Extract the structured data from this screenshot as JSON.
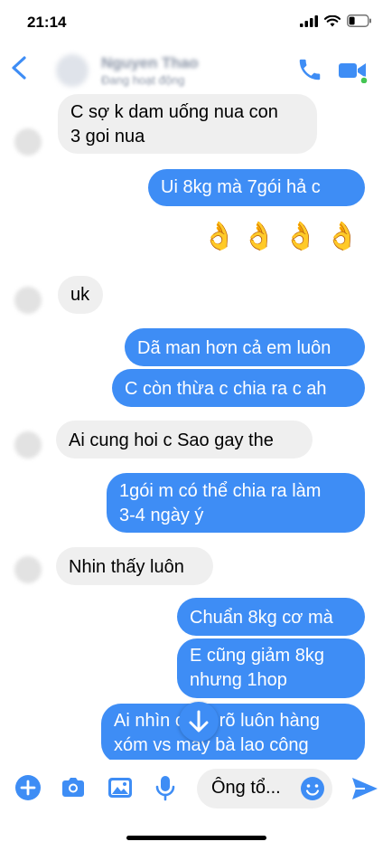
{
  "status_bar": {
    "time": "21:14"
  },
  "header": {
    "name": "Nguyen Thao",
    "status": "Đang hoạt động"
  },
  "messages": [
    {
      "side": "in",
      "text": "C sợ k dam uống nua con\n3 goi nua"
    },
    {
      "side": "out",
      "text": "Ui 8kg mà 7gói hả c"
    },
    {
      "side": "out",
      "text": "👌👌👌👌"
    },
    {
      "side": "in",
      "text": "uk"
    },
    {
      "side": "out",
      "text": "Dã man hơn cả em luôn"
    },
    {
      "side": "out",
      "text": "C còn thừa c chia ra c ah"
    },
    {
      "side": "in",
      "text": "Ai cung hoi c Sao gay the"
    },
    {
      "side": "out",
      "text": "1gói m có thể chia ra làm\n3-4 ngày ý"
    },
    {
      "side": "in",
      "text": "Nhin thấy luôn"
    },
    {
      "side": "out",
      "text": "Chuẩn 8kg cơ mà"
    },
    {
      "side": "out",
      "text": "E cũng giảm 8kg\nnhưng 1hop"
    },
    {
      "side": "out",
      "text": "Ai nhìn cũng rõ luôn hàng\nxóm vs mấy bà lao công"
    }
  ],
  "composer": {
    "input_value": "Ông tổ..."
  },
  "colors": {
    "accent": "#3e8df5",
    "incoming": "#efefef",
    "online": "#44c553"
  }
}
